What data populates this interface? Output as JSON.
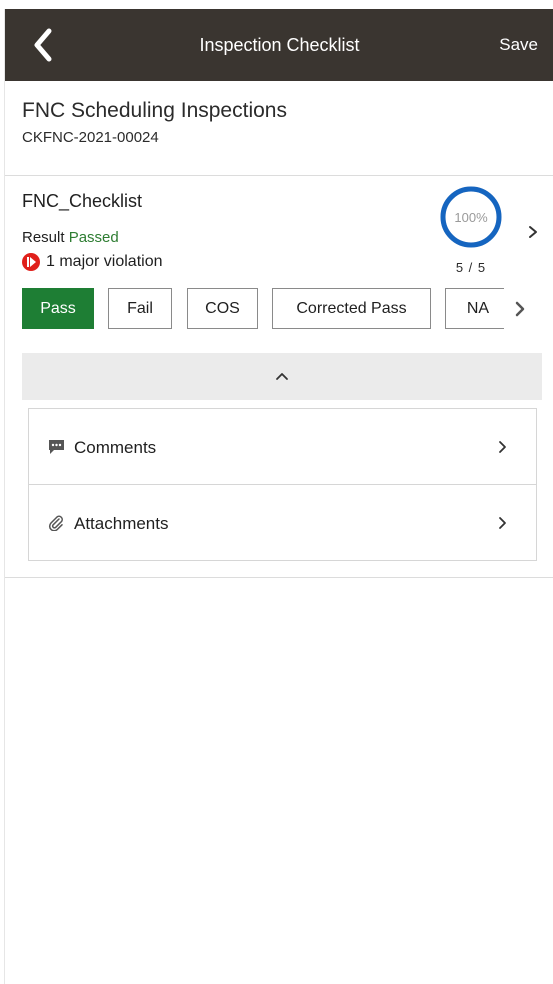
{
  "header": {
    "back_icon": "chevron-left-icon",
    "title": "Inspection Checklist",
    "save_label": "Save"
  },
  "record": {
    "title": "FNC Scheduling Inspections",
    "id": "CKFNC-2021-00024"
  },
  "checklist": {
    "name": "FNC_Checklist",
    "result_label": "Result",
    "result_value": "Passed",
    "violation_text": "1 major violation",
    "progress_percent_label": "100%",
    "progress_fraction": 1.0,
    "progress_count": "5 / 5",
    "result_buttons": [
      {
        "label": "Pass",
        "selected": true
      },
      {
        "label": "Fail",
        "selected": false
      },
      {
        "label": "COS",
        "selected": false
      },
      {
        "label": "Corrected Pass",
        "selected": false
      },
      {
        "label": "NA",
        "selected": false
      }
    ]
  },
  "details": [
    {
      "label": "Comments",
      "icon": "comment-icon"
    },
    {
      "label": "Attachments",
      "icon": "paperclip-icon"
    }
  ],
  "colors": {
    "header_bg": "#3a3530",
    "accent_blue": "#1565c0",
    "pass_green": "#1e7e34",
    "passed_text": "#2e7d32",
    "violation_red": "#e0201b"
  }
}
